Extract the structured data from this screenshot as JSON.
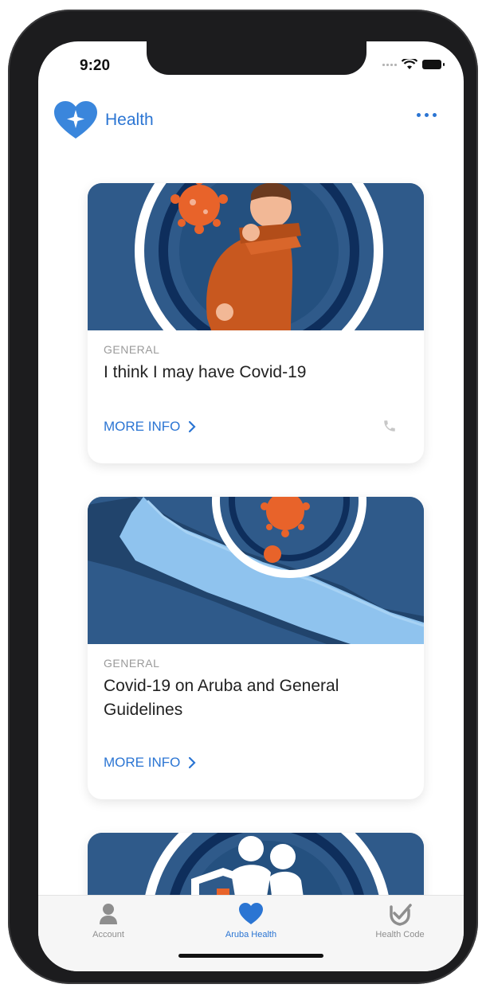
{
  "status_bar": {
    "time": "9:20"
  },
  "header": {
    "title": "Health",
    "logo_icon": "heart-star-icon",
    "menu_icon": "more-horizontal-icon"
  },
  "cards": [
    {
      "category": "GENERAL",
      "title": "I think I may have Covid-19",
      "link_label": "MORE INFO",
      "has_phone": true,
      "image": "person-coughing-illustration"
    },
    {
      "category": "GENERAL",
      "title": "Covid-19 on Aruba and General Guidelines",
      "link_label": "MORE INFO",
      "has_phone": false,
      "image": "aruba-map-virus-illustration"
    },
    {
      "image": "protection-shield-people-illustration"
    }
  ],
  "tabbar": {
    "tabs": [
      {
        "label": "Account",
        "icon": "person-icon",
        "active": false
      },
      {
        "label": "Aruba Health",
        "icon": "heart-icon",
        "active": true
      },
      {
        "label": "Health Code",
        "icon": "check-shield-icon",
        "active": false
      }
    ]
  },
  "colors": {
    "accent": "#2b75d3",
    "card_bg": "#2f5a8a",
    "virus": "#e8632a"
  }
}
